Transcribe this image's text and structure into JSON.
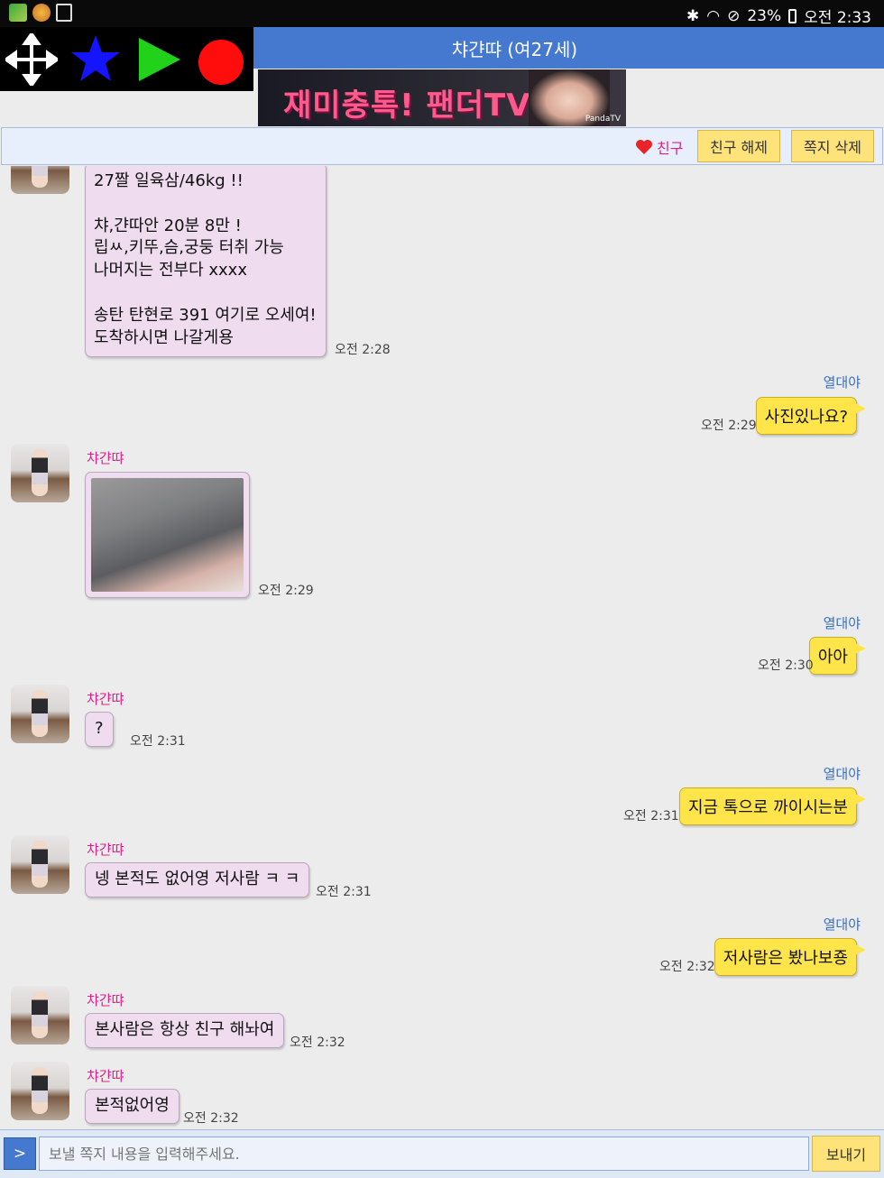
{
  "status_bar": {
    "battery": "23%",
    "time": "오전 2:33"
  },
  "window": {
    "title": "챠갼땨 (여27세)"
  },
  "banner": {
    "text": "재미충톡! 팬더TV",
    "logo": "PandaTV"
  },
  "actions": {
    "friend_label": "친구",
    "unfriend_label": "친구 해제",
    "delete_label": "쪽지 삭제"
  },
  "messages": [
    {
      "from": "them",
      "text": "27짤 일육삼/46kg !!\n\n 챠,갼따안 20분 8만 !\n립ㅆ,키뚜,슴,궁둥 터취 가능\n나머지는 전부다 xxxx\n\n송탄 탄현로 391 여기로 오세여!\n도착하시면 나갈게용",
      "time": "오전 2:28"
    },
    {
      "from": "me",
      "name": "열대야",
      "text": "사진있나요?",
      "time": "오전 2:29"
    },
    {
      "from": "them",
      "name": "챠갼땨",
      "text": "",
      "time": "오전 2:29"
    },
    {
      "from": "me",
      "name": "열대야",
      "text": "아아",
      "time": "오전 2:30"
    },
    {
      "from": "them",
      "name": "챠갼땨",
      "text": "?",
      "time": "오전 2:31"
    },
    {
      "from": "me",
      "name": "열대야",
      "text": "지금 톡으로 까이시는분",
      "time": "오전 2:31"
    },
    {
      "from": "them",
      "name": "챠갼땨",
      "text": "넹 본적도 없어영 저사람 ㅋ ㅋ",
      "time": "오전 2:31"
    },
    {
      "from": "me",
      "name": "열대야",
      "text": "저사람은 봤나보죵",
      "time": "오전 2:32"
    },
    {
      "from": "them",
      "name": "챠갼땨",
      "text": "본사람은 항상 친구 해놔여",
      "time": "오전 2:32"
    },
    {
      "from": "them",
      "name": "챠갼땨",
      "text": "본적없어영",
      "time": "오전 2:32"
    }
  ],
  "input": {
    "arrow": ">",
    "placeholder": "보낼 쪽지 내용을 입력해주세요.",
    "send_label": "보내기"
  },
  "colors": {
    "title_bar": "#4479cf",
    "incoming_bubble": "#efdcef",
    "outgoing_bubble": "#ffe54a",
    "button": "#fde37a",
    "sender_name": "#e0208a",
    "my_name": "#3a6fbf"
  }
}
